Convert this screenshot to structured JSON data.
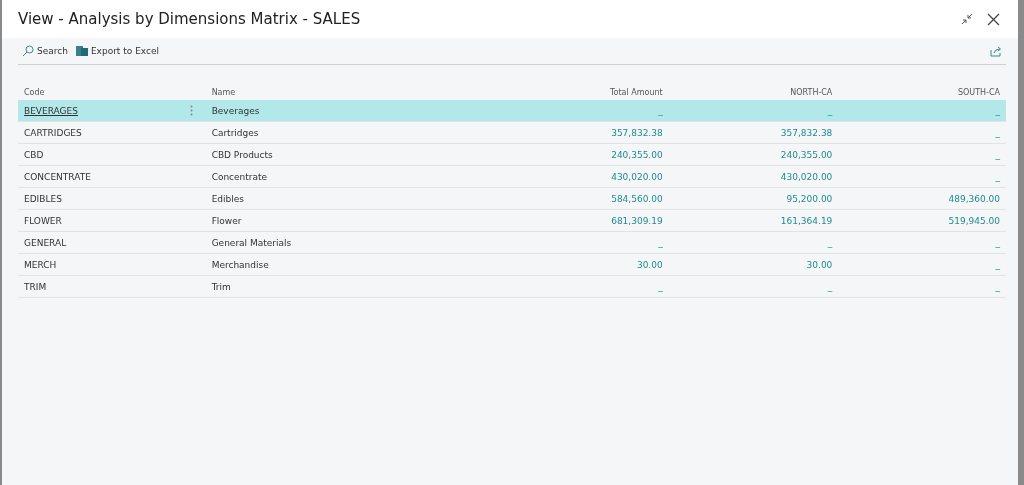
{
  "window": {
    "title": "View - Analysis by Dimensions Matrix - SALES"
  },
  "toolbar": [
    {
      "label": "Search",
      "kind": "search"
    },
    {
      "label": "Export to Excel",
      "kind": "excel"
    }
  ],
  "table": {
    "columns": [
      "Code",
      "Name",
      "Total Amount",
      "NORTH-CA",
      "SOUTH-CA"
    ],
    "rows": [
      {
        "code": "BEVERAGES",
        "name": "Beverages",
        "values": [
          "_",
          "_",
          "_"
        ],
        "selected": true
      },
      {
        "code": "CARTRIDGES",
        "name": "Cartridges",
        "values": [
          "357,832.38",
          "357,832.38",
          "_"
        ],
        "selected": false
      },
      {
        "code": "CBD",
        "name": "CBD Products",
        "values": [
          "240,355.00",
          "240,355.00",
          "_"
        ],
        "selected": false
      },
      {
        "code": "CONCENTRATE",
        "name": "Concentrate",
        "values": [
          "430,020.00",
          "430,020.00",
          "_"
        ],
        "selected": false
      },
      {
        "code": "EDIBLES",
        "name": "Edibles",
        "values": [
          "584,560.00",
          "95,200.00",
          "489,360.00"
        ],
        "selected": false
      },
      {
        "code": "FLOWER",
        "name": "Flower",
        "values": [
          "681,309.19",
          "161,364.19",
          "519,945.00"
        ],
        "selected": false
      },
      {
        "code": "GENERAL",
        "name": "General Materials",
        "values": [
          "_",
          "_",
          "_"
        ],
        "selected": false
      },
      {
        "code": "MERCH",
        "name": "Merchandise",
        "values": [
          "30.00",
          "30.00",
          "_"
        ],
        "selected": false
      },
      {
        "code": "TRIM",
        "name": "Trim",
        "values": [
          "_",
          "_",
          "_"
        ],
        "selected": false
      }
    ]
  }
}
